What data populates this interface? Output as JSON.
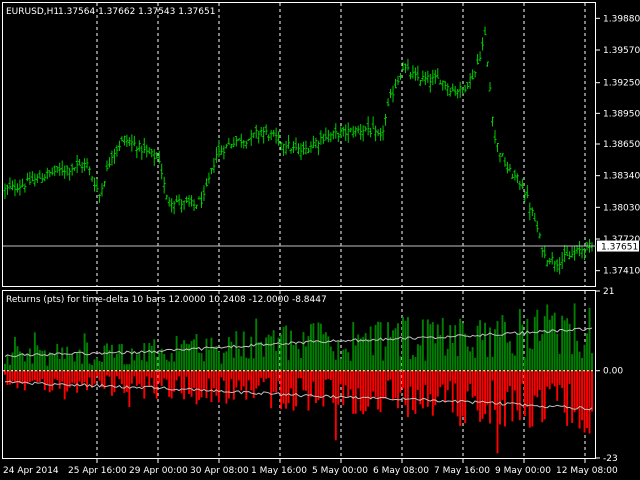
{
  "main_chart": {
    "symbol_label": "EURUSD,H1",
    "ohlc_label": "1.37564 1.37662 1.37543 1.37651",
    "last_price_label": "1.37651",
    "last_price": 1.37651,
    "ylim": [
      1.3726,
      1.4003
    ],
    "y_ticks": [
      "1.39880",
      "1.39570",
      "1.39250",
      "1.38950",
      "1.38650",
      "1.38340",
      "1.38030",
      "1.37720",
      "1.37410"
    ],
    "colors": {
      "bars": "#00cc00",
      "grid": "#ffffff",
      "background": "#000000",
      "text": "#ffffff"
    }
  },
  "indicator": {
    "label": "Returns (pts) for time-delta 10 bars 12.0000 10.2408 -12.0000 -8.8447",
    "ylim": [
      -23,
      21
    ],
    "y_ticks": [
      "21",
      "0.00",
      "-23"
    ],
    "colors": {
      "positive": "#008000",
      "negative": "#ff0000",
      "average_line": "#c0c0c0",
      "zero_line": "#ffffff"
    }
  },
  "time_axis": {
    "labels": [
      "24 Apr 2014",
      "25 Apr 16:00",
      "29 Apr 00:00",
      "30 Apr 08:00",
      "1 May 16:00",
      "5 May 00:00",
      "6 May 08:00",
      "7 May 16:00",
      "9 May 00:00",
      "12 May 08:00"
    ]
  },
  "chart_data": [
    {
      "type": "ohlc",
      "title": "EURUSD,H1",
      "ylim": [
        1.3726,
        1.4003
      ],
      "anchors": [
        [
          0,
          1.382
        ],
        [
          8,
          1.3826
        ],
        [
          14,
          1.3832
        ],
        [
          20,
          1.3838
        ],
        [
          27,
          1.3842
        ],
        [
          33,
          1.3845
        ],
        [
          38,
          1.3815
        ],
        [
          43,
          1.3855
        ],
        [
          48,
          1.387
        ],
        [
          52,
          1.3865
        ],
        [
          56,
          1.3858
        ],
        [
          62,
          1.385
        ],
        [
          65,
          1.3812
        ],
        [
          70,
          1.3808
        ],
        [
          76,
          1.3805
        ],
        [
          80,
          1.3812
        ],
        [
          85,
          1.3855
        ],
        [
          92,
          1.3868
        ],
        [
          98,
          1.387
        ],
        [
          103,
          1.3878
        ],
        [
          108,
          1.3872
        ],
        [
          112,
          1.3866
        ],
        [
          116,
          1.386
        ],
        [
          120,
          1.3858
        ],
        [
          124,
          1.3866
        ],
        [
          128,
          1.3872
        ],
        [
          134,
          1.3875
        ],
        [
          140,
          1.3878
        ],
        [
          146,
          1.388
        ],
        [
          151,
          1.387
        ],
        [
          155,
          1.391
        ],
        [
          160,
          1.394
        ],
        [
          165,
          1.393
        ],
        [
          170,
          1.3928
        ],
        [
          175,
          1.3928
        ],
        [
          180,
          1.3918
        ],
        [
          184,
          1.3918
        ],
        [
          189,
          1.3935
        ],
        [
          193,
          1.397
        ],
        [
          197,
          1.387
        ],
        [
          202,
          1.384
        ],
        [
          208,
          1.3825
        ],
        [
          213,
          1.379
        ],
        [
          217,
          1.3755
        ],
        [
          222,
          1.375
        ],
        [
          227,
          1.3755
        ],
        [
          232,
          1.3762
        ],
        [
          236,
          1.3765
        ]
      ],
      "last": 1.37651
    },
    {
      "type": "bar",
      "title": "Returns (pts) for time-delta 10 bars",
      "ylim": [
        -23,
        21
      ],
      "series": [
        {
          "name": "positive returns",
          "envelope": [
            [
              0,
              4
            ],
            [
              60,
              5
            ],
            [
              120,
              7.5
            ],
            [
              180,
              9
            ],
            [
              236,
              11
            ]
          ]
        },
        {
          "name": "negative returns",
          "envelope": [
            [
              0,
              -3
            ],
            [
              60,
              -4.5
            ],
            [
              120,
              -6.5
            ],
            [
              180,
              -8
            ],
            [
              236,
              -10
            ]
          ]
        }
      ]
    }
  ]
}
